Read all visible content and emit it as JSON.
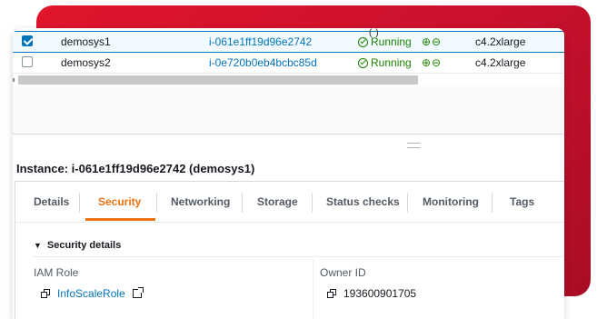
{
  "colors": {
    "accent_red": "#d4132a",
    "link_blue": "#0073bb",
    "running_green": "#1d8102",
    "active_tab_orange": "#ec7211"
  },
  "instances": [
    {
      "selected": true,
      "name": "demosys1",
      "instance_id": "i-061e1ff19d96e2742",
      "state": "Running",
      "state_icon": "check-circle-icon",
      "zoom_icons": "⊕⊖",
      "type": "c4.2xlarge"
    },
    {
      "selected": false,
      "name": "demosys2",
      "instance_id": "i-0e720b0eb4bcbc85d",
      "state": "Running",
      "state_icon": "check-circle-icon",
      "zoom_icons": "⊕⊖",
      "type": "c4.2xlarge"
    }
  ],
  "details": {
    "title": "Instance: i-061e1ff19d96e2742 (demosys1)",
    "tabs": [
      {
        "label": "Details",
        "active": false
      },
      {
        "label": "Security",
        "active": true
      },
      {
        "label": "Networking",
        "active": false
      },
      {
        "label": "Storage",
        "active": false
      },
      {
        "label": "Status checks",
        "active": false
      },
      {
        "label": "Monitoring",
        "active": false
      },
      {
        "label": "Tags",
        "active": false
      }
    ],
    "section_title": "Security details",
    "iam_role_label": "IAM Role",
    "iam_role_value": "InfoScaleRole",
    "owner_id_label": "Owner ID",
    "owner_id_value": "193600901705"
  }
}
